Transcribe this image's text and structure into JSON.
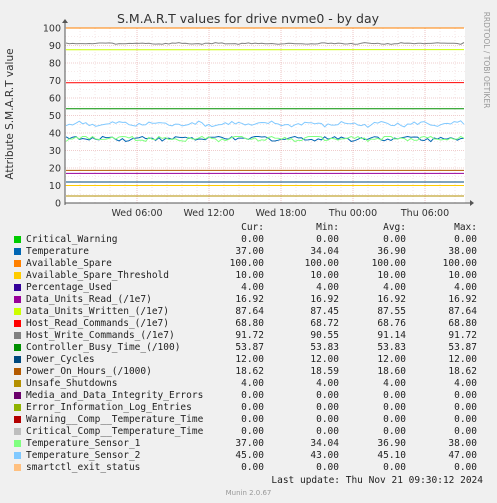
{
  "chart_data": {
    "type": "line",
    "title": "S.M.A.R.T values for drive nvme0 - by day",
    "ylabel": "Attribute S.M.A.R.T value",
    "ylim": [
      0,
      100
    ],
    "yticks": [
      0,
      10,
      20,
      30,
      40,
      50,
      60,
      70,
      80,
      90,
      100
    ],
    "xticks": [
      "Wed 06:00",
      "Wed 12:00",
      "Wed 18:00",
      "Thu 00:00",
      "Thu 06:00"
    ],
    "columns": [
      "Cur:",
      "Min:",
      "Avg:",
      "Max:"
    ],
    "side_label": "RRDTOOL / TOBI OETIKER",
    "last_update": "Last update: Thu Nov 21 09:30:12 2024",
    "footer": "Munin 2.0.67",
    "series": [
      {
        "name": "Critical_Warning",
        "color": "#00cc00",
        "cur": "0.00",
        "min": "0.00",
        "avg": "0.00",
        "max": "0.00"
      },
      {
        "name": "Temperature",
        "color": "#0066b3",
        "cur": "37.00",
        "min": "34.04",
        "avg": "36.90",
        "max": "38.00"
      },
      {
        "name": "Available_Spare",
        "color": "#ff8000",
        "cur": "100.00",
        "min": "100.00",
        "avg": "100.00",
        "max": "100.00"
      },
      {
        "name": "Available_Spare_Threshold",
        "color": "#ffcc00",
        "cur": "10.00",
        "min": "10.00",
        "avg": "10.00",
        "max": "10.00"
      },
      {
        "name": "Percentage_Used",
        "color": "#330099",
        "cur": "4.00",
        "min": "4.00",
        "avg": "4.00",
        "max": "4.00"
      },
      {
        "name": "Data_Units_Read_(/1e7)",
        "color": "#990099",
        "cur": "16.92",
        "min": "16.92",
        "avg": "16.92",
        "max": "16.92"
      },
      {
        "name": "Data_Units_Written_(/1e7)",
        "color": "#ccff00",
        "cur": "87.64",
        "min": "87.45",
        "avg": "87.55",
        "max": "87.64"
      },
      {
        "name": "Host_Read_Commands_(/1e7)",
        "color": "#ff0000",
        "cur": "68.80",
        "min": "68.72",
        "avg": "68.76",
        "max": "68.80"
      },
      {
        "name": "Host_Write_Commands_(/1e7)",
        "color": "#808080",
        "cur": "91.72",
        "min": "90.55",
        "avg": "91.14",
        "max": "91.72"
      },
      {
        "name": "Controller_Busy_Time_(/100)",
        "color": "#008f00",
        "cur": "53.87",
        "min": "53.83",
        "avg": "53.83",
        "max": "53.87"
      },
      {
        "name": "Power_Cycles",
        "color": "#00487d",
        "cur": "12.00",
        "min": "12.00",
        "avg": "12.00",
        "max": "12.00"
      },
      {
        "name": "Power_On_Hours_(/1000)",
        "color": "#b35a00",
        "cur": "18.62",
        "min": "18.59",
        "avg": "18.60",
        "max": "18.62"
      },
      {
        "name": "Unsafe_Shutdowns",
        "color": "#b38f00",
        "cur": "4.00",
        "min": "4.00",
        "avg": "4.00",
        "max": "4.00"
      },
      {
        "name": "Media_and_Data_Integrity_Errors",
        "color": "#6b006b",
        "cur": "0.00",
        "min": "0.00",
        "avg": "0.00",
        "max": "0.00"
      },
      {
        "name": "Error_Information_Log_Entries",
        "color": "#8fb300",
        "cur": "0.00",
        "min": "0.00",
        "avg": "0.00",
        "max": "0.00"
      },
      {
        "name": "Warning__Comp__Temperature_Time",
        "color": "#b30000",
        "cur": "0.00",
        "min": "0.00",
        "avg": "0.00",
        "max": "0.00"
      },
      {
        "name": "Critical_Comp__Temperature_Time",
        "color": "#bebebe",
        "cur": "0.00",
        "min": "0.00",
        "avg": "0.00",
        "max": "0.00"
      },
      {
        "name": "Temperature_Sensor_1",
        "color": "#80ff80",
        "cur": "37.00",
        "min": "34.04",
        "avg": "36.90",
        "max": "38.00"
      },
      {
        "name": "Temperature_Sensor_2",
        "color": "#80c9ff",
        "cur": "45.00",
        "min": "43.00",
        "avg": "45.10",
        "max": "47.00"
      },
      {
        "name": "smartctl_exit_status",
        "color": "#ffc080",
        "cur": "0.00",
        "min": "0.00",
        "avg": "0.00",
        "max": "0.00"
      }
    ]
  }
}
